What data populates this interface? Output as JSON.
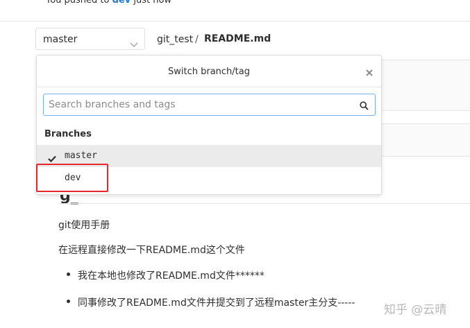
{
  "notice": {
    "prefix": "You pushed to",
    "branch": "dev",
    "suffix": "just now"
  },
  "branch_select": {
    "value": "master"
  },
  "breadcrumb": {
    "repo": "git_test",
    "separator": "/",
    "file": "README.md"
  },
  "dropdown": {
    "title": "Switch branch/tag",
    "search_placeholder": "Search branches and tags",
    "section_label": "Branches",
    "branches": [
      {
        "name": "master",
        "checked": true
      },
      {
        "name": "dev",
        "checked": false
      }
    ]
  },
  "content": {
    "heading_fragment": "g_",
    "paragraph1": "git使用手册",
    "paragraph2": "在远程直接修改一下README.md这个文件",
    "list": [
      "我在本地也修改了README.md文件******",
      "同事修改了README.md文件并提交到了远程master主分支-----"
    ]
  },
  "watermark": "知乎 @云晴",
  "colors": {
    "link": "#1f78d1",
    "highlight_box": "#e8262a",
    "search_focus": "#73afea"
  }
}
